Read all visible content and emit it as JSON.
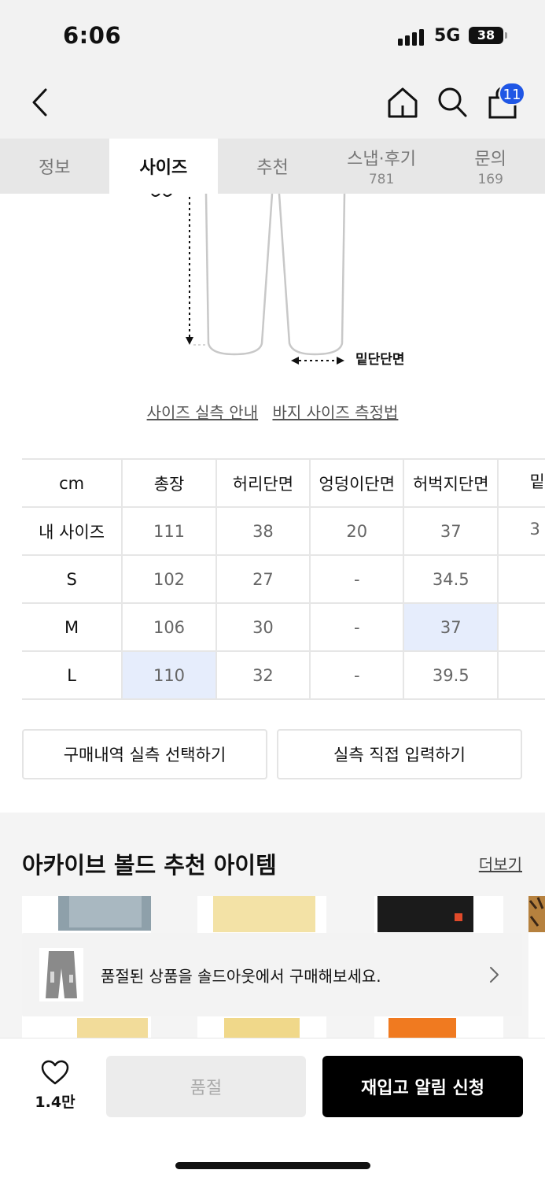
{
  "status_bar": {
    "time": "6:06",
    "network": "5G",
    "battery": "38"
  },
  "nav": {
    "cart_count": "11"
  },
  "tabs": [
    {
      "label": "정보",
      "count": ""
    },
    {
      "label": "사이즈",
      "count": ""
    },
    {
      "label": "추천",
      "count": ""
    },
    {
      "label": "스냅·후기",
      "count": "781"
    },
    {
      "label": "문의",
      "count": "169"
    }
  ],
  "active_tab": "사이즈",
  "diagram": {
    "hem_label": "밑단단면"
  },
  "guide_links": {
    "actual_size_guide": "사이즈 실측 안내",
    "pants_measure": "바지 사이즈 측정법"
  },
  "size_table": {
    "headers": [
      "cm",
      "총장",
      "허리단면",
      "엉덩이단면",
      "허벅지단면",
      "밑"
    ],
    "rows": [
      {
        "label": "내 사이즈",
        "values": [
          "111",
          "38",
          "20",
          "37",
          "3"
        ]
      },
      {
        "label": "S",
        "values": [
          "102",
          "27",
          "-",
          "34.5",
          ""
        ]
      },
      {
        "label": "M",
        "values": [
          "106",
          "30",
          "-",
          "37",
          ""
        ]
      },
      {
        "label": "L",
        "values": [
          "110",
          "32",
          "-",
          "39.5",
          ""
        ]
      }
    ],
    "highlight_color": "#e6edfc"
  },
  "actions": {
    "purchase_history": "구매내역 실측 선택하기",
    "direct_input": "실측 직접 입력하기"
  },
  "recommend": {
    "title": "아카이브 볼드 추천 아이템",
    "more": "더보기",
    "soldout_banner": "품절된 상품을 솔드아웃에서 구매해보세요."
  },
  "bottom": {
    "like_count": "1.4만",
    "soldout_label": "품절",
    "restock_label": "재입고 알림 신청"
  },
  "colors": {
    "accent_blue": "#1f56e5",
    "primary_black": "#000000"
  }
}
